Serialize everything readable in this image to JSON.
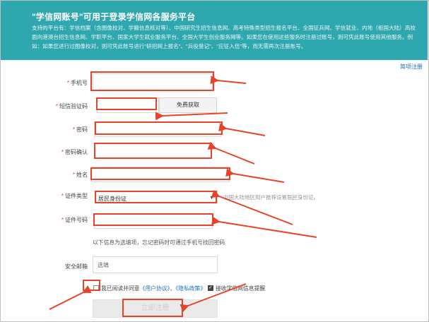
{
  "banner": {
    "title": "\"学信网账号\"可用于登录学信网各服务平台",
    "description": "支持的平台有：学信档案（含图像校对、学籍信息核对等）、中国研究生招生信息网、高考特殊类型招生报名平台、全国征兵网、学信就业、内地（祖国大陆）高校面向港澳台招生信息网、学职平台、国家大学生就业服务平台、全国大学生创业服务网等。如果您在使用这些服务时注册过账号，则可凭此账号使用其他服务。例如：如果您进行过图像校对，则可凭此账号进行\"研招网上报名\"、\"兵役登记\"、\"应征入伍\"等，而无需再次注册账号。"
  },
  "simple_register": "简项注册",
  "form": {
    "phone_label": "手机号",
    "sms_label": "短信验证码",
    "sms_button": "免费获取",
    "password_label": "密码",
    "confirm_label": "密码确认",
    "name_label": "姓名",
    "idtype_label": "证件类型",
    "idtype_value": "居民身份证",
    "idtype_hint": "中国大陆地区用户推荐设置居民身份证。",
    "idnum_label": "证件号码",
    "optional_note": "以下信息为选填项，忘记密码时可通过手机号找回密码",
    "email_label": "安全邮箱",
    "email_placeholder": "选填",
    "required_mark": "*"
  },
  "agreement": {
    "text1": "我已阅读并同意",
    "user_agreement": "《用户协议》",
    "sep": "、",
    "privacy": "《隐私政策》",
    "subscribe": "接收学信网信息提醒"
  },
  "submit_label": "立即注册",
  "colors": {
    "banner": "#2ea7ae",
    "highlight": "#e8432a",
    "link": "#1a6fc1"
  }
}
